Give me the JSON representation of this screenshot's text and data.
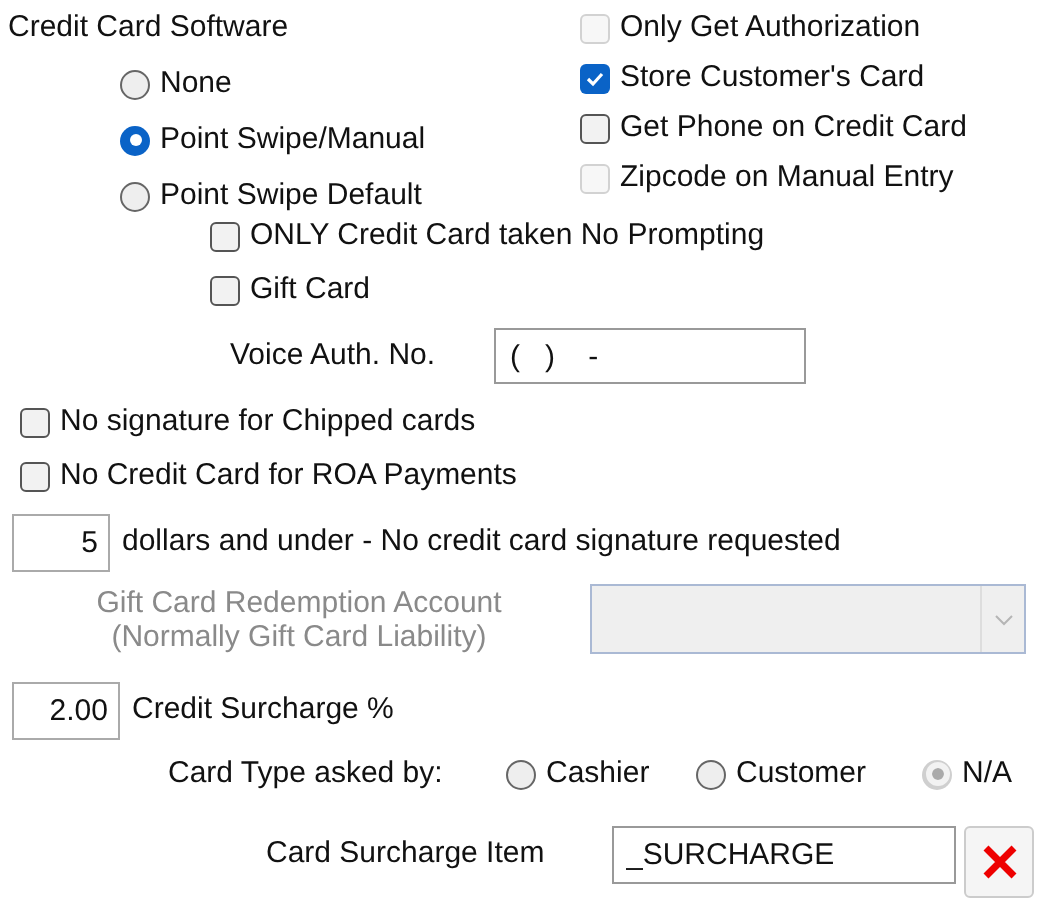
{
  "title": "Credit Card Software",
  "software_options": [
    {
      "label": "None",
      "selected": false
    },
    {
      "label": "Point Swipe/Manual",
      "selected": true
    },
    {
      "label": "Point Swipe Default",
      "selected": false
    }
  ],
  "right_options": [
    {
      "label": "Only Get Authorization",
      "checked": false,
      "disabled": true
    },
    {
      "label": "Store Customer's Card",
      "checked": true,
      "disabled": false
    },
    {
      "label": "Get Phone on Credit Card",
      "checked": false,
      "disabled": false
    },
    {
      "label": "Zipcode on Manual Entry",
      "checked": false,
      "disabled": true
    }
  ],
  "sub_options": [
    {
      "label": "ONLY Credit Card taken No Prompting",
      "checked": false
    },
    {
      "label": "Gift Card",
      "checked": false
    }
  ],
  "voice_auth": {
    "label": "Voice Auth. No.",
    "value": "(   )    -"
  },
  "options": [
    {
      "label": "No signature for Chipped cards",
      "checked": false
    },
    {
      "label": "No Credit Card for ROA Payments",
      "checked": false
    }
  ],
  "signature_limit": {
    "value": "5",
    "label": "dollars and under - No credit card signature requested"
  },
  "gift_card_account": {
    "label_lines": [
      "Gift Card Redemption Account",
      "(Normally Gift Card Liability)"
    ],
    "disabled": true
  },
  "surcharge": {
    "value": "2.00",
    "label": "Credit Surcharge %"
  },
  "card_type": {
    "label": "Card Type asked by:",
    "options": [
      {
        "label": "Cashier",
        "selected": false,
        "disabled": false
      },
      {
        "label": "Customer",
        "selected": false,
        "disabled": false
      },
      {
        "label": "N/A",
        "selected": true,
        "disabled": true
      }
    ]
  },
  "surcharge_item": {
    "label": "Card Surcharge Item",
    "value": "_SURCHARGE"
  }
}
